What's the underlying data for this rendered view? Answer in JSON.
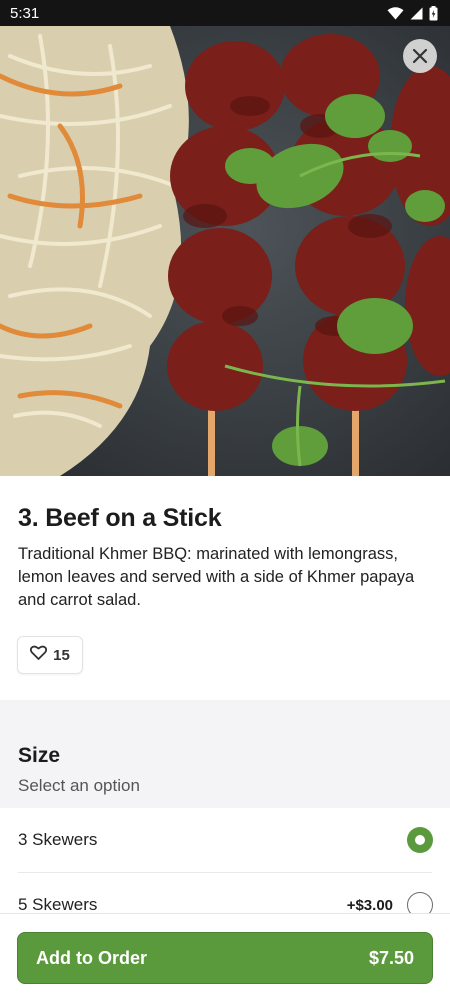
{
  "status_bar": {
    "time": "5:31"
  },
  "item": {
    "title": "3. Beef on a Stick",
    "description": "Traditional Khmer BBQ: marinated with lemongrass, lemon leaves and served with a side of Khmer papaya and carrot salad.",
    "likes": "15"
  },
  "option_group": {
    "title": "Size",
    "subtitle": "Select an option",
    "options": [
      {
        "label": "3 Skewers",
        "price": "",
        "selected": true
      },
      {
        "label": "5 Skewers",
        "price": "+$3.00",
        "selected": false
      }
    ]
  },
  "order_button": {
    "label": "Add to Order",
    "price": "$7.50"
  },
  "colors": {
    "accent": "#5a9a3c",
    "status_bar": "#141414"
  },
  "icons": [
    "wifi-icon",
    "signal-icon",
    "battery-icon",
    "close-icon",
    "heart-icon"
  ]
}
